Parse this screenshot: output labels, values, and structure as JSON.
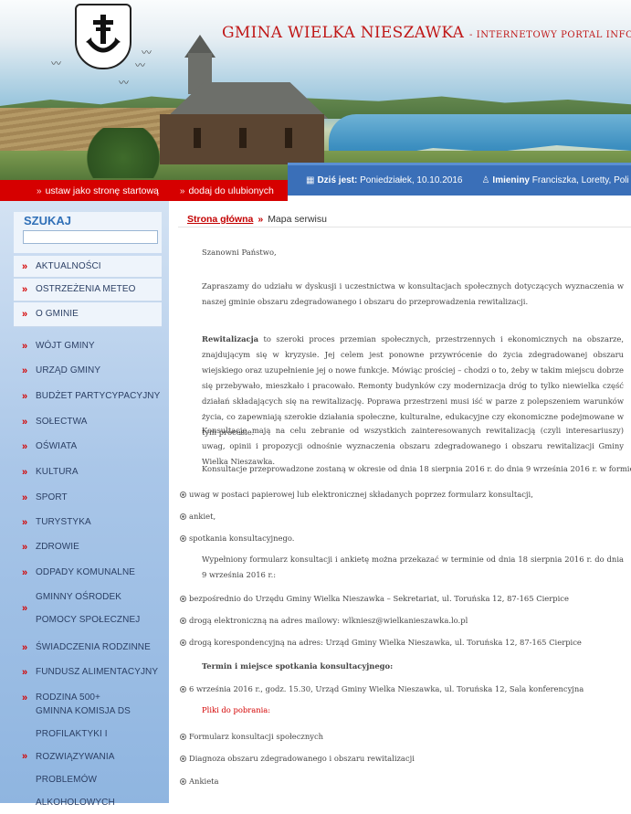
{
  "header": {
    "title_main": "GMINA WIELKA NIESZAWKA",
    "title_sub": "- INTERNETOWY PORTAL INFORMACYJNY"
  },
  "redbar": {
    "links": [
      "ustaw jako stronę startową",
      "dodaj do ulubionych"
    ]
  },
  "datebar": {
    "date_label": "Dziś jest:",
    "date_value": "Poniedziałek, 10.10.2016",
    "names_label": "Imieniny",
    "names_value": "Franciszka, Loretty, Poli"
  },
  "sidebar": {
    "search_label": "SZUKAJ",
    "search_value": "",
    "items": [
      "AKTUALNOŚCI",
      "OSTRZEŻENIA METEO",
      "O GMINIE",
      "WÓJT GMINY",
      "URZĄD GMINY",
      "BUDŻET PARTYCYPACYJNY",
      "SOŁECTWA",
      "OŚWIATA",
      "KULTURA",
      "SPORT",
      "TURYSTYKA",
      "ZDROWIE",
      "ODPADY KOMUNALNE",
      "GMINNY OŚRODEK POMOCY SPOŁECZNEJ",
      "ŚWIADCZENIA RODZINNE",
      "FUNDUSZ ALIMENTACYJNY",
      "RODZINA 500+",
      "GMINNA KOMISJA DS PROFILAKTYKI I ROZWIĄZYWANIA PROBLEMÓW ALKOHOLOWYCH"
    ]
  },
  "breadcrumb": {
    "home": "Strona główna",
    "separator": "»",
    "current": "Mapa serwisu"
  },
  "content": {
    "greeting": "Szanowni Państwo,",
    "p1": "Zapraszamy do udziału w dyskusji i uczestnictwa w konsultacjach społecznych dotyczących wyznaczenia w naszej gminie obszaru zdegradowanego i obszaru do przeprowadzenia rewitalizacji.",
    "p2_bold": "Rewitalizacja",
    "p2_rest": " to szeroki proces przemian społecznych, przestrzennych i ekonomicznych na obszarze, znajdującym się w kryzysie. Jej celem jest ponowne przywrócenie do życia zdegradowanej obszaru wiejskiego oraz uzupełnienie jej o nowe funkcje. Mówiąc prościej – chodzi o to, żeby w takim miejscu dobrze się przebywało, mieszkało i pracowało. Remonty budynków czy modernizacja dróg to tylko niewielka część działań składających się na rewitalizację. Poprawa przestrzeni musi iść w parze z polepszeniem warunków życia, co zapewniają szerokie działania społeczne, kulturalne, edukacyjne czy ekonomiczne podejmowane w tym procesie.",
    "p3": "Konsultacje mają na celu zebranie od wszystkich zainteresowanych rewitalizacją (czyli interesariuszy) uwag, opinii i propozycji odnośnie wyznaczenia obszaru zdegradowanego i obszaru rewitalizacji Gminy Wielka Nieszawka.",
    "p4": "Konsultacje przeprowadzone zostaną w okresie od dnia 18 sierpnia 2016 r. do dnia 9 września 2016 r. w formie:",
    "forms": [
      "uwag w postaci papierowej lub elektronicznej składanych poprzez formularz konsultacji,",
      "ankiet,",
      "spotkania konsultacyjnego."
    ],
    "p5": "Wypełniony formularz konsultacji i ankietę można przekazać w terminie od dnia 18 sierpnia 2016 r. do dnia 9 września 2016 r.:",
    "channels": [
      "bezpośrednio do Urzędu Gminy Wielka Nieszawka – Sekretariat, ul. Toruńska 12, 87-165 Cierpice",
      "drogą elektroniczną na adres mailowy: wlkniesz@wielkanieszawka.lo.pl",
      "drogą korespondencyjną na adres: Urząd Gminy Wielka Nieszawka, ul. Toruńska 12, 87-165 Cierpice"
    ],
    "meeting_heading": "Termin i miejsce spotkania konsultacyjnego:",
    "meeting": "6 września 2016 r., godz. 15.30, Urząd Gminy Wielka Nieszawka, ul. Toruńska 12, Sala konferencyjna",
    "files_heading": "Pliki do pobrania:",
    "files": [
      "Formularz konsultacji społecznych",
      "Diagnoza obszaru zdegradowanego i obszaru rewitalizacji",
      "Ankieta"
    ]
  },
  "colors": {
    "accent_red": "#d60000",
    "date_blue": "#3a6fb8",
    "sidebar_blue": "#a9c6e8",
    "title_red": "#c01818"
  }
}
